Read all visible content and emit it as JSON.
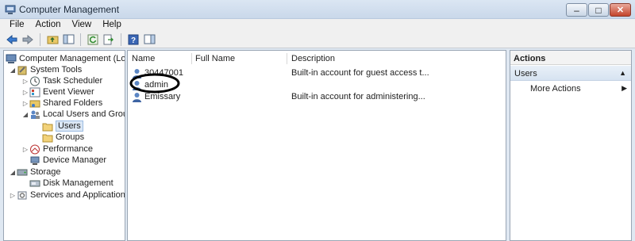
{
  "window": {
    "title": "Computer Management",
    "controls": {
      "minimize": "–",
      "maximize": "□",
      "close": "✕"
    }
  },
  "menu": [
    "File",
    "Action",
    "View",
    "Help"
  ],
  "tree": [
    {
      "label": "Computer Management (Local",
      "arrow": "",
      "icon": "computer-management-icon"
    },
    {
      "label": "System Tools",
      "arrow": "◢",
      "icon": "system-tools-icon"
    },
    {
      "label": "Task Scheduler",
      "arrow": "▷",
      "icon": "clock-icon"
    },
    {
      "label": "Event Viewer",
      "arrow": "▷",
      "icon": "event-viewer-icon"
    },
    {
      "label": "Shared Folders",
      "arrow": "▷",
      "icon": "shared-folder-icon"
    },
    {
      "label": "Local Users and Groups",
      "arrow": "◢",
      "icon": "users-groups-icon"
    },
    {
      "label": "Users",
      "arrow": "",
      "icon": "folder-icon"
    },
    {
      "label": "Groups",
      "arrow": "",
      "icon": "folder-icon"
    },
    {
      "label": "Performance",
      "arrow": "▷",
      "icon": "performance-icon"
    },
    {
      "label": "Device Manager",
      "arrow": "",
      "icon": "device-manager-icon"
    },
    {
      "label": "Storage",
      "arrow": "◢",
      "icon": "storage-icon"
    },
    {
      "label": "Disk Management",
      "arrow": "",
      "icon": "disk-icon"
    },
    {
      "label": "Services and Applications",
      "arrow": "▷",
      "icon": "services-icon"
    }
  ],
  "list": {
    "columns": [
      "Name",
      "Full Name",
      "Description"
    ],
    "rows": [
      {
        "name": "30447001",
        "full_name": "",
        "description": "Built-in account for guest access t..."
      },
      {
        "name": "admin",
        "full_name": "",
        "description": ""
      },
      {
        "name": "Emissary",
        "full_name": "",
        "description": "Built-in account for administering..."
      }
    ]
  },
  "actions": {
    "header": "Actions",
    "section": "Users",
    "section_caret": "▲",
    "items": [
      {
        "label": "More Actions",
        "submenu": "▶"
      }
    ]
  },
  "colors": {
    "selection": "#dbe7f5",
    "annotation": "#000000",
    "window_bg": "#dfe8f2"
  }
}
